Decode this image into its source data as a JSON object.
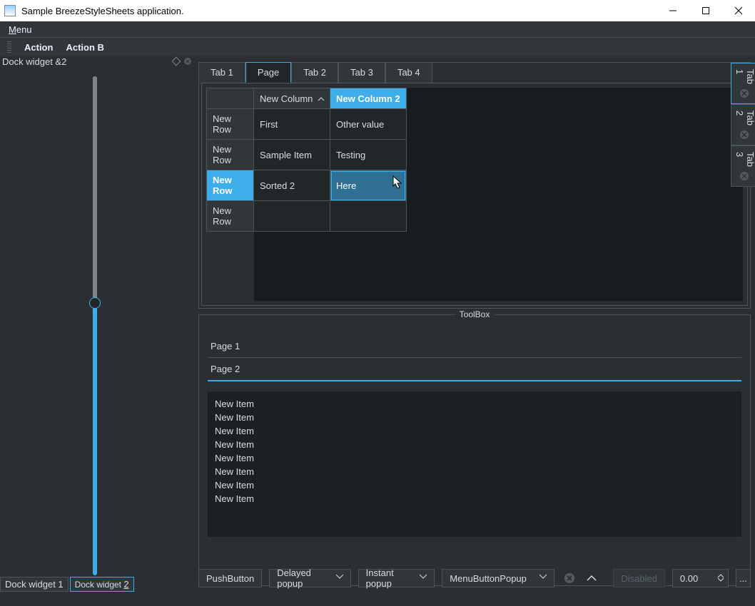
{
  "window": {
    "title": "Sample BreezeStyleSheets application."
  },
  "menubar": {
    "menu": "Menu"
  },
  "actionbar": {
    "action": "Action",
    "action_b": "Action B"
  },
  "dock_left": {
    "title": "Dock widget &2",
    "bottom_tabs": [
      "Dock widget 1",
      "Dock widget 2"
    ],
    "active_bottom_tab": 1
  },
  "top_tabs": {
    "items": [
      "Tab 1",
      "Page",
      "Tab 2",
      "Tab 3",
      "Tab 4"
    ],
    "active": 1
  },
  "table": {
    "columns": [
      "New Column",
      "New Column 2"
    ],
    "selected_col": 1,
    "sort_col": 0,
    "sort_dir": "asc",
    "rows": [
      {
        "header": "New Row",
        "cells": [
          "First",
          "Other value"
        ]
      },
      {
        "header": "New Row",
        "cells": [
          "Sample Item",
          "Testing"
        ]
      },
      {
        "header": "New Row",
        "cells": [
          "Sorted 2",
          "Here"
        ],
        "selected": true
      },
      {
        "header": "New Row",
        "cells": [
          "",
          ""
        ]
      }
    ]
  },
  "toolbox": {
    "label": "ToolBox",
    "pages": [
      "Page 1",
      "Page 2"
    ],
    "active_page": 1,
    "list": [
      "New Item",
      "New Item",
      "New Item",
      "New Item",
      "New Item",
      "New Item",
      "New Item",
      "New Item"
    ]
  },
  "right_tabs": {
    "items": [
      "Tab 1",
      "Tab 2",
      "Tab 3"
    ],
    "active": 0
  },
  "bottom": {
    "push": "PushButton",
    "delayed": "Delayed popup",
    "instant": "Instant popup",
    "menubtn": "MenuButtonPopup",
    "disabled": "Disabled",
    "spin": "0.00",
    "ellipsis": "..."
  }
}
